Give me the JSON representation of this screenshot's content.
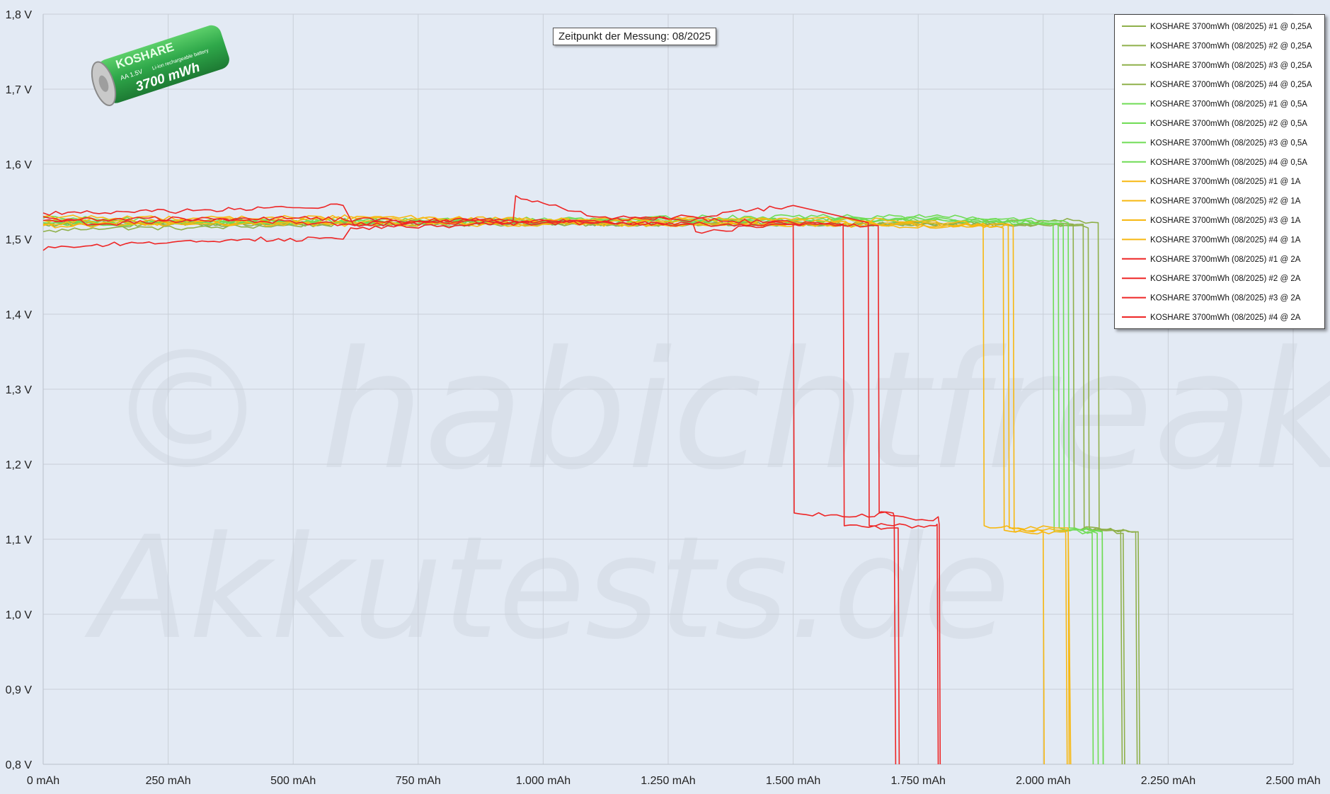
{
  "chart_data": {
    "type": "line",
    "watermark": [
      "© habichtfreak",
      "Akkutests.de"
    ],
    "annotation": "Zeitpunkt der Messung: 08/2025",
    "product_badge": {
      "brand": "KOSHARE",
      "size": "AA 1.5V",
      "type": "Li-ion rechargeable battery",
      "capacity": "3700 mWh"
    },
    "xlim": [
      0,
      2500
    ],
    "ylim": [
      0.8,
      1.8
    ],
    "x_ticks": [
      0,
      250,
      500,
      750,
      1000,
      1250,
      1500,
      1750,
      2000,
      2250,
      2500
    ],
    "x_tick_labels": [
      "0 mAh",
      "250 mAh",
      "500 mAh",
      "750 mAh",
      "1.000 mAh",
      "1.250 mAh",
      "1.500 mAh",
      "1.750 mAh",
      "2.000 mAh",
      "2.250 mAh",
      "2.500 mAh"
    ],
    "y_ticks": [
      0.8,
      0.9,
      1.0,
      1.1,
      1.2,
      1.3,
      1.4,
      1.5,
      1.6,
      1.7,
      1.8
    ],
    "y_tick_labels": [
      "0,8 V",
      "0,9 V",
      "1,0 V",
      "1,1 V",
      "1,2 V",
      "1,3 V",
      "1,4 V",
      "1,5 V",
      "1,6 V",
      "1,7 V",
      "1,8 V"
    ],
    "grid": true,
    "legend_position": "top-right",
    "colors": {
      "0.25A": "#8fb04a",
      "0.5A": "#6fdc55",
      "1A": "#f7b811",
      "2A": "#ee2626"
    },
    "series": [
      {
        "name": "KOSHARE 3700mWh (08/2025) #1 @ 0,25A",
        "color": "#8fb04a",
        "x": [
          0,
          100,
          300,
          600,
          1000,
          1400,
          1800,
          2050,
          2090,
          2092,
          2100,
          2150,
          2170,
          2185,
          2188
        ],
        "y": [
          1.51,
          1.515,
          1.515,
          1.52,
          1.52,
          1.52,
          1.52,
          1.518,
          1.515,
          1.115,
          1.112,
          1.11,
          1.11,
          1.11,
          0.8
        ]
      },
      {
        "name": "KOSHARE 3700mWh (08/2025) #2 @ 0,25A",
        "color": "#8fb04a",
        "x": [
          0,
          200,
          500,
          800,
          1200,
          1600,
          1900,
          2060,
          2110,
          2112,
          2140,
          2190,
          2193
        ],
        "y": [
          1.52,
          1.52,
          1.52,
          1.522,
          1.52,
          1.52,
          1.522,
          1.525,
          1.522,
          1.112,
          1.112,
          1.11,
          0.8
        ]
      },
      {
        "name": "KOSHARE 3700mWh (08/2025) #3 @ 0,25A",
        "color": "#8fb04a",
        "x": [
          0,
          200,
          500,
          900,
          1300,
          1700,
          2000,
          2080,
          2082,
          2120,
          2155,
          2158
        ],
        "y": [
          1.525,
          1.522,
          1.52,
          1.52,
          1.522,
          1.52,
          1.52,
          1.52,
          1.115,
          1.112,
          1.112,
          0.8
        ]
      },
      {
        "name": "KOSHARE 3700mWh (08/2025) #4 @ 0,25A",
        "color": "#8fb04a",
        "x": [
          0,
          150,
          400,
          800,
          1200,
          1600,
          1950,
          2060,
          2062,
          2110,
          2160,
          2163
        ],
        "y": [
          1.52,
          1.518,
          1.522,
          1.522,
          1.52,
          1.52,
          1.52,
          1.52,
          1.115,
          1.115,
          1.108,
          0.8
        ]
      },
      {
        "name": "KOSHARE 3700mWh (08/2025) #1 @ 0,5A",
        "color": "#6fdc55",
        "x": [
          0,
          300,
          700,
          1100,
          1500,
          1800,
          2000,
          2040,
          2042,
          2100,
          2108,
          2110
        ],
        "y": [
          1.525,
          1.522,
          1.522,
          1.525,
          1.525,
          1.525,
          1.522,
          1.52,
          1.112,
          1.11,
          1.108,
          0.8
        ]
      },
      {
        "name": "KOSHARE 3700mWh (08/2025) #2 @ 0,5A",
        "color": "#6fdc55",
        "x": [
          0,
          300,
          700,
          1100,
          1500,
          1800,
          2000,
          2030,
          2032,
          2110,
          2118,
          2120
        ],
        "y": [
          1.52,
          1.522,
          1.522,
          1.525,
          1.525,
          1.528,
          1.522,
          1.52,
          1.115,
          1.112,
          1.11,
          0.8
        ]
      },
      {
        "name": "KOSHARE 3700mWh (08/2025) #3 @ 0,5A",
        "color": "#6fdc55",
        "x": [
          0,
          300,
          700,
          1100,
          1500,
          1800,
          2000,
          2050,
          2052,
          2100,
          2118,
          2120
        ],
        "y": [
          1.528,
          1.525,
          1.525,
          1.528,
          1.53,
          1.53,
          1.525,
          1.522,
          1.115,
          1.112,
          1.11,
          0.8
        ]
      },
      {
        "name": "KOSHARE 3700mWh (08/2025) #4 @ 0,5A",
        "color": "#6fdc55",
        "x": [
          0,
          300,
          700,
          1100,
          1500,
          1800,
          2000,
          2020,
          2022,
          2090,
          2098,
          2100
        ],
        "y": [
          1.522,
          1.522,
          1.525,
          1.525,
          1.525,
          1.525,
          1.52,
          1.52,
          1.11,
          1.11,
          1.108,
          0.8
        ]
      },
      {
        "name": "KOSHARE 3700mWh (08/2025) #1 @ 1A",
        "color": "#f7b811",
        "x": [
          0,
          300,
          700,
          1000,
          1400,
          1700,
          1880,
          1882,
          1950,
          2050,
          2055
        ],
        "y": [
          1.53,
          1.528,
          1.53,
          1.525,
          1.528,
          1.525,
          1.52,
          1.118,
          1.115,
          1.115,
          0.8
        ]
      },
      {
        "name": "KOSHARE 3700mWh (08/2025) #2 @ 1A",
        "color": "#f7b811",
        "x": [
          0,
          300,
          700,
          1000,
          1400,
          1700,
          1930,
          1932,
          2000,
          2050,
          2052
        ],
        "y": [
          1.525,
          1.525,
          1.528,
          1.525,
          1.525,
          1.52,
          1.518,
          1.115,
          1.112,
          1.112,
          0.8
        ]
      },
      {
        "name": "KOSHARE 3700mWh (08/2025) #3 @ 1A",
        "color": "#f7b811",
        "x": [
          0,
          300,
          700,
          1000,
          1400,
          1700,
          1940,
          1942,
          2000,
          2045,
          2048
        ],
        "y": [
          1.52,
          1.522,
          1.522,
          1.52,
          1.52,
          1.52,
          1.518,
          1.11,
          1.11,
          1.11,
          0.8
        ]
      },
      {
        "name": "KOSHARE 3700mWh (08/2025) #4 @ 1A",
        "color": "#f7b811",
        "x": [
          0,
          300,
          700,
          1000,
          1400,
          1700,
          1920,
          1922,
          1980,
          2000,
          2002
        ],
        "y": [
          1.518,
          1.52,
          1.52,
          1.52,
          1.52,
          1.518,
          1.515,
          1.112,
          1.11,
          1.11,
          0.8
        ]
      },
      {
        "name": "KOSHARE 3700mWh (08/2025) #1 @ 2A",
        "color": "#ee2626",
        "x": [
          0,
          10,
          50,
          200,
          400,
          600,
          615,
          800,
          1000,
          1300,
          1305,
          1500,
          1502,
          1600,
          1700,
          1702,
          1705
        ],
        "y": [
          1.485,
          1.49,
          1.49,
          1.495,
          1.5,
          1.5,
          1.515,
          1.518,
          1.522,
          1.52,
          1.51,
          1.52,
          1.135,
          1.13,
          1.135,
          1.13,
          0.8
        ]
      },
      {
        "name": "KOSHARE 3700mWh (08/2025) #2 @ 2A",
        "color": "#ee2626",
        "x": [
          0,
          50,
          200,
          400,
          600,
          800,
          940,
          945,
          1000,
          1100,
          1500,
          1600,
          1602,
          1700,
          1705,
          1710,
          1712
        ],
        "y": [
          1.525,
          1.525,
          1.528,
          1.525,
          1.52,
          1.525,
          1.525,
          1.558,
          1.548,
          1.53,
          1.522,
          1.52,
          1.118,
          1.115,
          1.115,
          1.115,
          0.8
        ]
      },
      {
        "name": "KOSHARE 3700mWh (08/2025) #3 @ 2A",
        "color": "#ee2626",
        "x": [
          0,
          100,
          300,
          500,
          600,
          620,
          800,
          1100,
          1300,
          1500,
          1650,
          1652,
          1700,
          1750,
          1785,
          1788,
          1790
        ],
        "y": [
          1.535,
          1.535,
          1.538,
          1.542,
          1.545,
          1.52,
          1.522,
          1.525,
          1.53,
          1.545,
          1.522,
          1.118,
          1.118,
          1.118,
          1.118,
          1.12,
          0.8
        ]
      },
      {
        "name": "KOSHARE 3700mWh (08/2025) #4 @ 2A",
        "color": "#ee2626",
        "x": [
          0,
          100,
          300,
          500,
          700,
          900,
          1100,
          1300,
          1500,
          1670,
          1672,
          1720,
          1770,
          1790,
          1792,
          1794
        ],
        "y": [
          1.53,
          1.52,
          1.525,
          1.528,
          1.525,
          1.525,
          1.522,
          1.52,
          1.52,
          1.518,
          1.135,
          1.13,
          1.125,
          1.13,
          1.12,
          0.8
        ]
      }
    ]
  }
}
